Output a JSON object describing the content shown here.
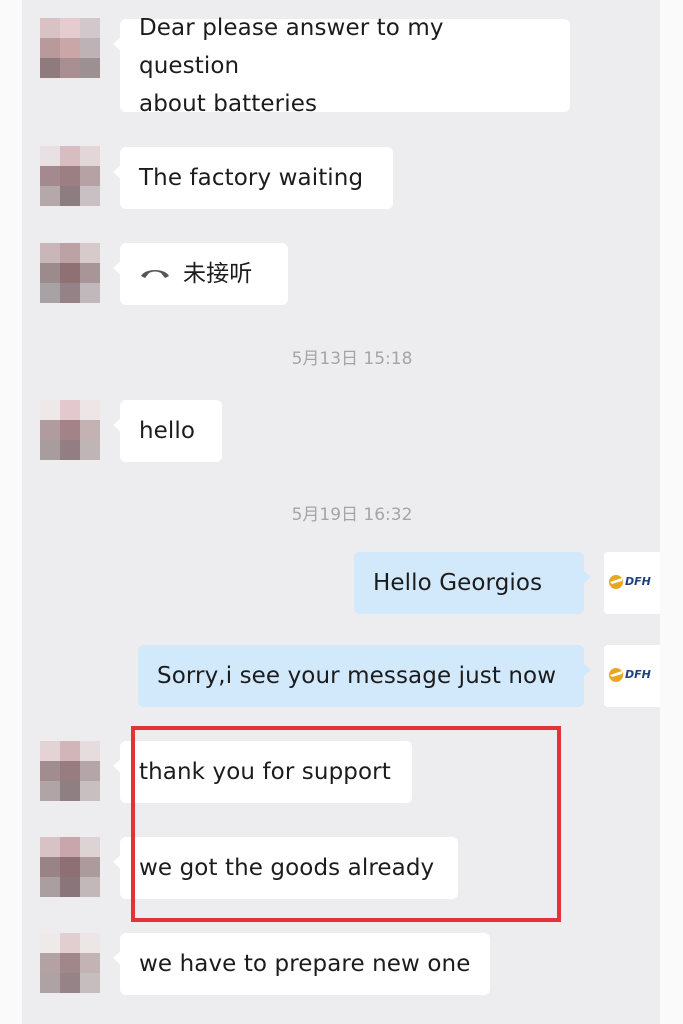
{
  "messages": [
    {
      "from": "contact",
      "lines": [
        "Dear please answer to my question",
        "about batteries"
      ]
    },
    {
      "from": "contact",
      "text": "The factory waiting"
    },
    {
      "from": "contact",
      "text": "未接听",
      "icon": "phone-hangup-icon"
    },
    {
      "from": "contact",
      "text": "hello"
    },
    {
      "from": "me",
      "text": "Hello Georgios"
    },
    {
      "from": "me",
      "text": "Sorry,i see your message just now"
    },
    {
      "from": "contact",
      "text": "thank you for support"
    },
    {
      "from": "contact",
      "text": "we got the goods already"
    },
    {
      "from": "contact",
      "text": "we have to prepare new one"
    }
  ],
  "timestamps": [
    "5月13日  15:18",
    "5月19日  16:32"
  ],
  "brand": {
    "logo_text": "DFH",
    "colors": {
      "gold": "#e9a620",
      "blue": "#1f3f7f"
    }
  },
  "colors": {
    "highlight": "#e2333b",
    "self_bubble": "#d2e8fb",
    "contact_bubble": "#ffffff",
    "background": "#ededef"
  }
}
